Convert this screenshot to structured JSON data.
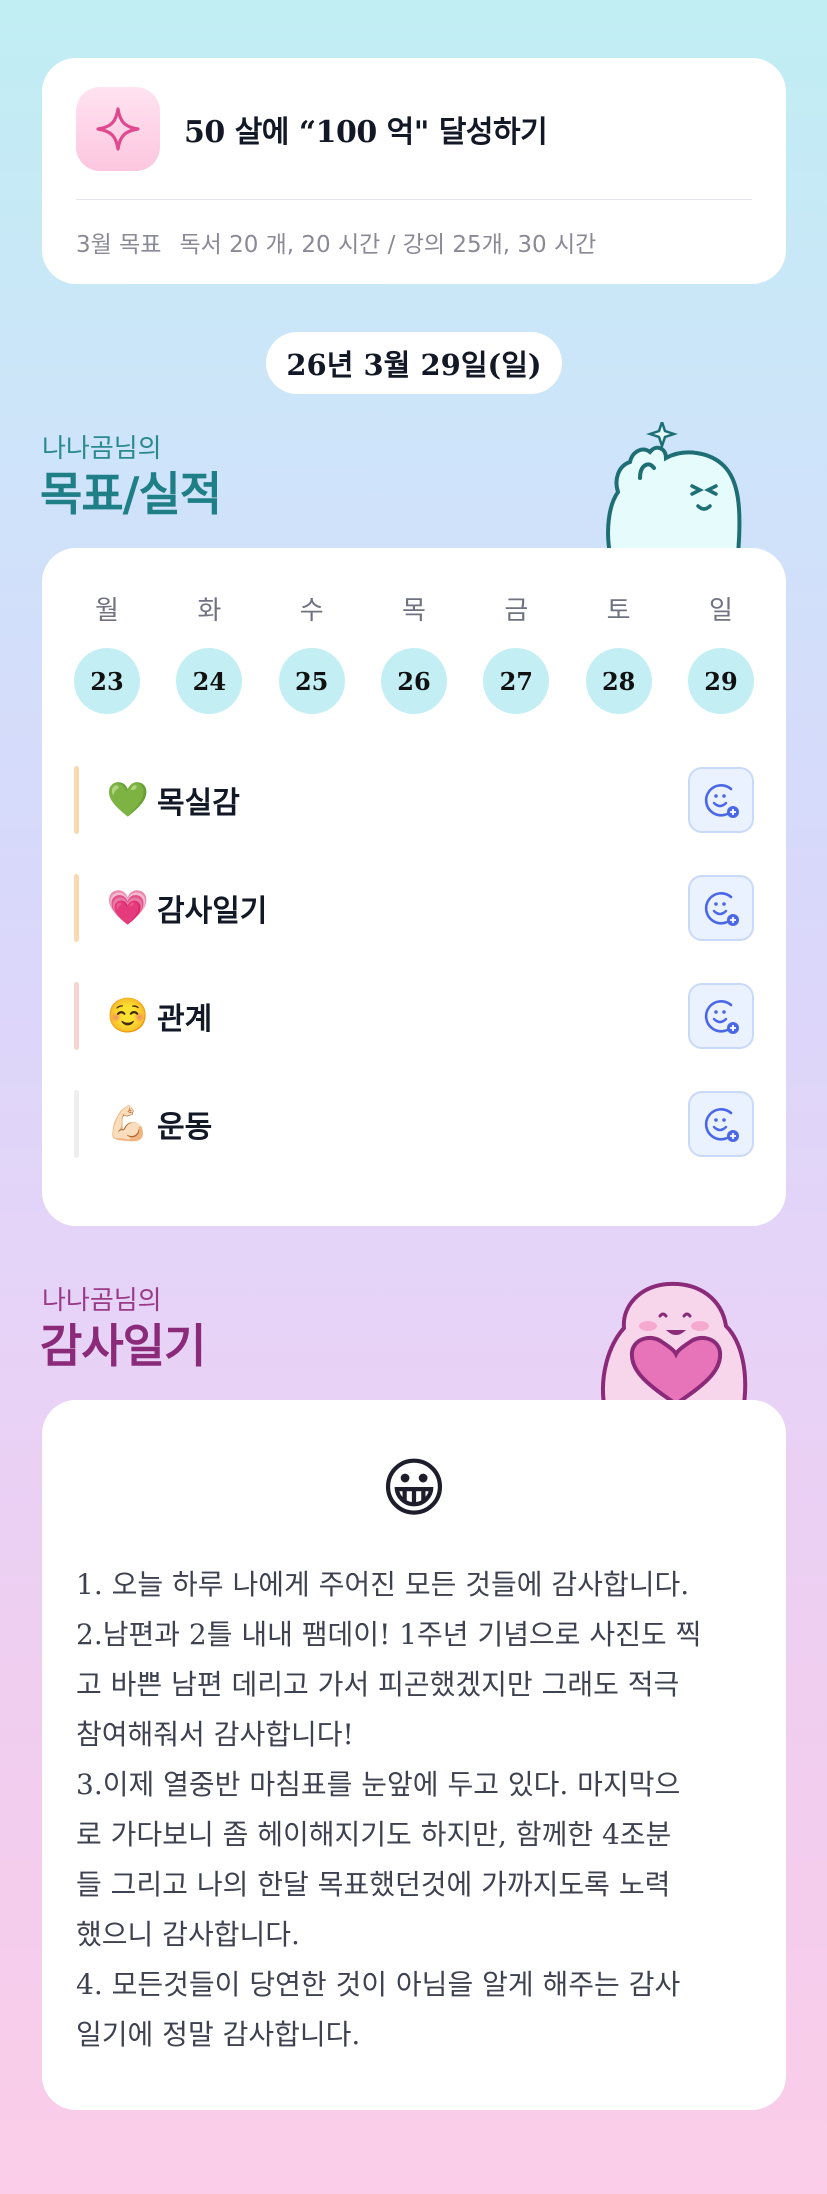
{
  "goal": {
    "title": "50 살에 “100 억\" 달성하기",
    "month_label": "3월 목표",
    "month_goal": "독서 20 개, 20 시간 / 강의 25개, 30 시간",
    "icon": "sparkle-icon"
  },
  "date": "26년 3월 29일(일)",
  "goals_section": {
    "owner": "나나곰님의",
    "title": "목표/실적"
  },
  "week": {
    "days": [
      {
        "label": "월",
        "num": "23"
      },
      {
        "label": "화",
        "num": "24"
      },
      {
        "label": "수",
        "num": "25"
      },
      {
        "label": "목",
        "num": "26"
      },
      {
        "label": "금",
        "num": "27"
      },
      {
        "label": "토",
        "num": "28"
      },
      {
        "label": "일",
        "num": "29"
      }
    ]
  },
  "habits": [
    {
      "emoji": "💚",
      "name": "목실감",
      "bar_color": "#fbd9b0"
    },
    {
      "emoji": "💗",
      "name": "감사일기",
      "bar_color": "#fbd9b0"
    },
    {
      "emoji": "☺️",
      "name": "관계",
      "bar_color": "#f8d3d0"
    },
    {
      "emoji": "💪🏻",
      "name": "운동",
      "bar_color": "#eeeeee"
    }
  ],
  "diary_section": {
    "owner": "나나곰님의",
    "title": "감사일기"
  },
  "diary": {
    "emoji": "😀",
    "lines": [
      "1. 오늘 하루 나에게 주어진 모든 것들에 감사합니다.",
      "2.남편과 2틀 내내 팸데이! 1주년 기념으로 사진도 찍",
      "고 바쁜 남편 데리고 가서 피곤했겠지만 그래도 적극",
      "참여해줘서 감사합니다!",
      "3.이제 열중반 마침표를 눈앞에 두고 있다. 마지막으",
      "로 가다보니 좀 헤이해지기도 하지만, 함께한 4조분",
      "들 그리고 나의 한달 목표했던것에 가까지도록 노력",
      "했으니 감사합니다.",
      "4. 모든것들이 당연한 것이 아님을 알게 해주는 감사",
      "일기에 정말 감사합니다."
    ]
  },
  "colors": {
    "day_circle": "#c3eff4",
    "teal_title": "#1f7f86",
    "purple_title": "#8a2a78",
    "action_button_bg": "#eaf1ff"
  }
}
